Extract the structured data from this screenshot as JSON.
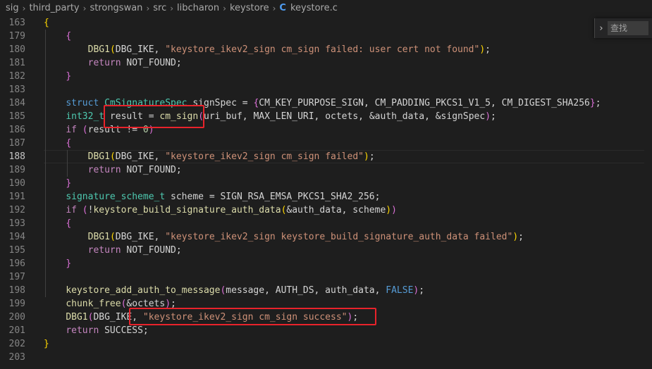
{
  "breadcrumb": {
    "items": [
      "sig",
      "third_party",
      "strongswan",
      "src",
      "libcharon",
      "keystore"
    ],
    "file_icon": "C",
    "file": "keystore.c"
  },
  "find": {
    "placeholder": "查找"
  },
  "lines": [
    {
      "n": "163",
      "tokens": [
        [
          "b1",
          "{"
        ]
      ]
    },
    {
      "n": "179",
      "tokens": [
        [
          "ws",
          "    "
        ],
        [
          "b2",
          "{"
        ]
      ]
    },
    {
      "n": "180",
      "tokens": [
        [
          "ws",
          "        "
        ],
        [
          "fn",
          "DBG1"
        ],
        [
          "b1",
          "("
        ],
        [
          "p",
          "DBG_IKE, "
        ],
        [
          "str",
          "\"keystore_ikev2_sign cm_sign failed: user cert not found\""
        ],
        [
          "b1",
          ")"
        ],
        [
          "p",
          ";"
        ]
      ]
    },
    {
      "n": "181",
      "tokens": [
        [
          "ws",
          "        "
        ],
        [
          "ctrl",
          "return"
        ],
        [
          "p",
          " NOT_FOUND;"
        ]
      ]
    },
    {
      "n": "182",
      "tokens": [
        [
          "ws",
          "    "
        ],
        [
          "b2",
          "}"
        ]
      ]
    },
    {
      "n": "183",
      "tokens": []
    },
    {
      "n": "184",
      "tokens": [
        [
          "ws",
          "    "
        ],
        [
          "kw",
          "struct"
        ],
        [
          "p",
          " "
        ],
        [
          "type",
          "CmSignatureSpec"
        ],
        [
          "p",
          " signSpec = "
        ],
        [
          "b2",
          "{"
        ],
        [
          "p",
          "CM_KEY_PURPOSE_SIGN, CM_PADDING_PKCS1_V1_5, CM_DIGEST_SHA256"
        ],
        [
          "b2",
          "}"
        ],
        [
          "p",
          ";"
        ]
      ]
    },
    {
      "n": "185",
      "tokens": [
        [
          "ws",
          "    "
        ],
        [
          "type",
          "int32_t"
        ],
        [
          "p",
          " result = "
        ],
        [
          "fn",
          "cm_sign"
        ],
        [
          "b2",
          "("
        ],
        [
          "p",
          "uri_buf, MAX_LEN_URI, octets, &auth_data, &signSpec"
        ],
        [
          "b2",
          ")"
        ],
        [
          "p",
          ";"
        ]
      ]
    },
    {
      "n": "186",
      "tokens": [
        [
          "ws",
          "    "
        ],
        [
          "ctrl",
          "if"
        ],
        [
          "p",
          " "
        ],
        [
          "b2",
          "("
        ],
        [
          "p",
          "result != "
        ],
        [
          "num",
          "0"
        ],
        [
          "b2",
          ")"
        ]
      ]
    },
    {
      "n": "187",
      "tokens": [
        [
          "ws",
          "    "
        ],
        [
          "b2",
          "{"
        ]
      ]
    },
    {
      "n": "188",
      "tokens": [
        [
          "ws",
          "        "
        ],
        [
          "fn",
          "DBG1"
        ],
        [
          "b1",
          "("
        ],
        [
          "p",
          "DBG_IKE, "
        ],
        [
          "str",
          "\"keystore_ikev2_sign cm_sign failed\""
        ],
        [
          "b1",
          ")"
        ],
        [
          "p",
          ";"
        ]
      ],
      "active": true
    },
    {
      "n": "189",
      "tokens": [
        [
          "ws",
          "        "
        ],
        [
          "ctrl",
          "return"
        ],
        [
          "p",
          " NOT_FOUND;"
        ]
      ]
    },
    {
      "n": "190",
      "tokens": [
        [
          "ws",
          "    "
        ],
        [
          "b2",
          "}"
        ]
      ]
    },
    {
      "n": "191",
      "tokens": [
        [
          "ws",
          "    "
        ],
        [
          "type",
          "signature_scheme_t"
        ],
        [
          "p",
          " scheme = SIGN_RSA_EMSA_PKCS1_SHA2_256;"
        ]
      ]
    },
    {
      "n": "192",
      "tokens": [
        [
          "ws",
          "    "
        ],
        [
          "ctrl",
          "if"
        ],
        [
          "p",
          " "
        ],
        [
          "b2",
          "("
        ],
        [
          "p",
          "!"
        ],
        [
          "fn",
          "keystore_build_signature_auth_data"
        ],
        [
          "b1",
          "("
        ],
        [
          "p",
          "&auth_data, scheme"
        ],
        [
          "b1",
          ")"
        ],
        [
          "b2",
          ")"
        ]
      ]
    },
    {
      "n": "193",
      "tokens": [
        [
          "ws",
          "    "
        ],
        [
          "b2",
          "{"
        ]
      ]
    },
    {
      "n": "194",
      "tokens": [
        [
          "ws",
          "        "
        ],
        [
          "fn",
          "DBG1"
        ],
        [
          "b1",
          "("
        ],
        [
          "p",
          "DBG_IKE, "
        ],
        [
          "str",
          "\"keystore_ikev2_sign keystore_build_signature_auth_data failed\""
        ],
        [
          "b1",
          ")"
        ],
        [
          "p",
          ";"
        ]
      ]
    },
    {
      "n": "195",
      "tokens": [
        [
          "ws",
          "        "
        ],
        [
          "ctrl",
          "return"
        ],
        [
          "p",
          " NOT_FOUND;"
        ]
      ]
    },
    {
      "n": "196",
      "tokens": [
        [
          "ws",
          "    "
        ],
        [
          "b2",
          "}"
        ]
      ]
    },
    {
      "n": "197",
      "tokens": []
    },
    {
      "n": "198",
      "tokens": [
        [
          "ws",
          "    "
        ],
        [
          "fn",
          "keystore_add_auth_to_message"
        ],
        [
          "b2",
          "("
        ],
        [
          "p",
          "message, AUTH_DS, auth_data, "
        ],
        [
          "kw",
          "FALSE"
        ],
        [
          "b2",
          ")"
        ],
        [
          "p",
          ";"
        ]
      ]
    },
    {
      "n": "199",
      "tokens": [
        [
          "ws",
          "    "
        ],
        [
          "fn",
          "chunk_free"
        ],
        [
          "b2",
          "("
        ],
        [
          "p",
          "&octets"
        ],
        [
          "b2",
          ")"
        ],
        [
          "p",
          ";"
        ]
      ]
    },
    {
      "n": "200",
      "tokens": [
        [
          "ws",
          "    "
        ],
        [
          "fn",
          "DBG1"
        ],
        [
          "b2",
          "("
        ],
        [
          "p",
          "DBG_IKE, "
        ],
        [
          "str",
          "\"keystore_ikev2_sign cm_sign success\""
        ],
        [
          "b2",
          ")"
        ],
        [
          "p",
          ";"
        ]
      ]
    },
    {
      "n": "201",
      "tokens": [
        [
          "ws",
          "    "
        ],
        [
          "ctrl",
          "return"
        ],
        [
          "p",
          " SUCCESS;"
        ]
      ]
    },
    {
      "n": "202",
      "tokens": [
        [
          "b1",
          "}"
        ]
      ]
    },
    {
      "n": "203",
      "tokens": []
    }
  ]
}
